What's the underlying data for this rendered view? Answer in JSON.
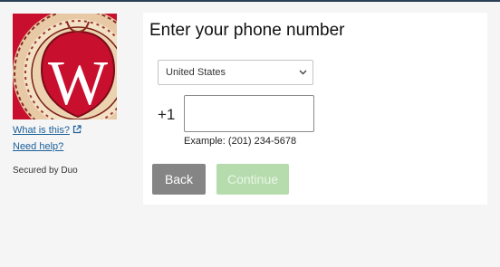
{
  "sidebar": {
    "logo_alt": "University of Wisconsin crest",
    "links": {
      "what_is_this": "What is this?",
      "need_help": "Need help?"
    },
    "secured_by": "Secured by Duo"
  },
  "main": {
    "title": "Enter your phone number",
    "country_select": {
      "selected": "United States"
    },
    "dial_code": "+1",
    "phone_input": {
      "value": "",
      "placeholder": ""
    },
    "example": "Example: (201) 234-5678",
    "buttons": {
      "back": "Back",
      "continue": "Continue"
    }
  },
  "colors": {
    "logo_red": "#c8102e",
    "link": "#1b5f99",
    "back_button": "#858585",
    "continue_button_disabled": "#b6dcae"
  },
  "icons": {
    "external_link": "external-link-icon",
    "dropdown": "chevron-down-icon"
  }
}
